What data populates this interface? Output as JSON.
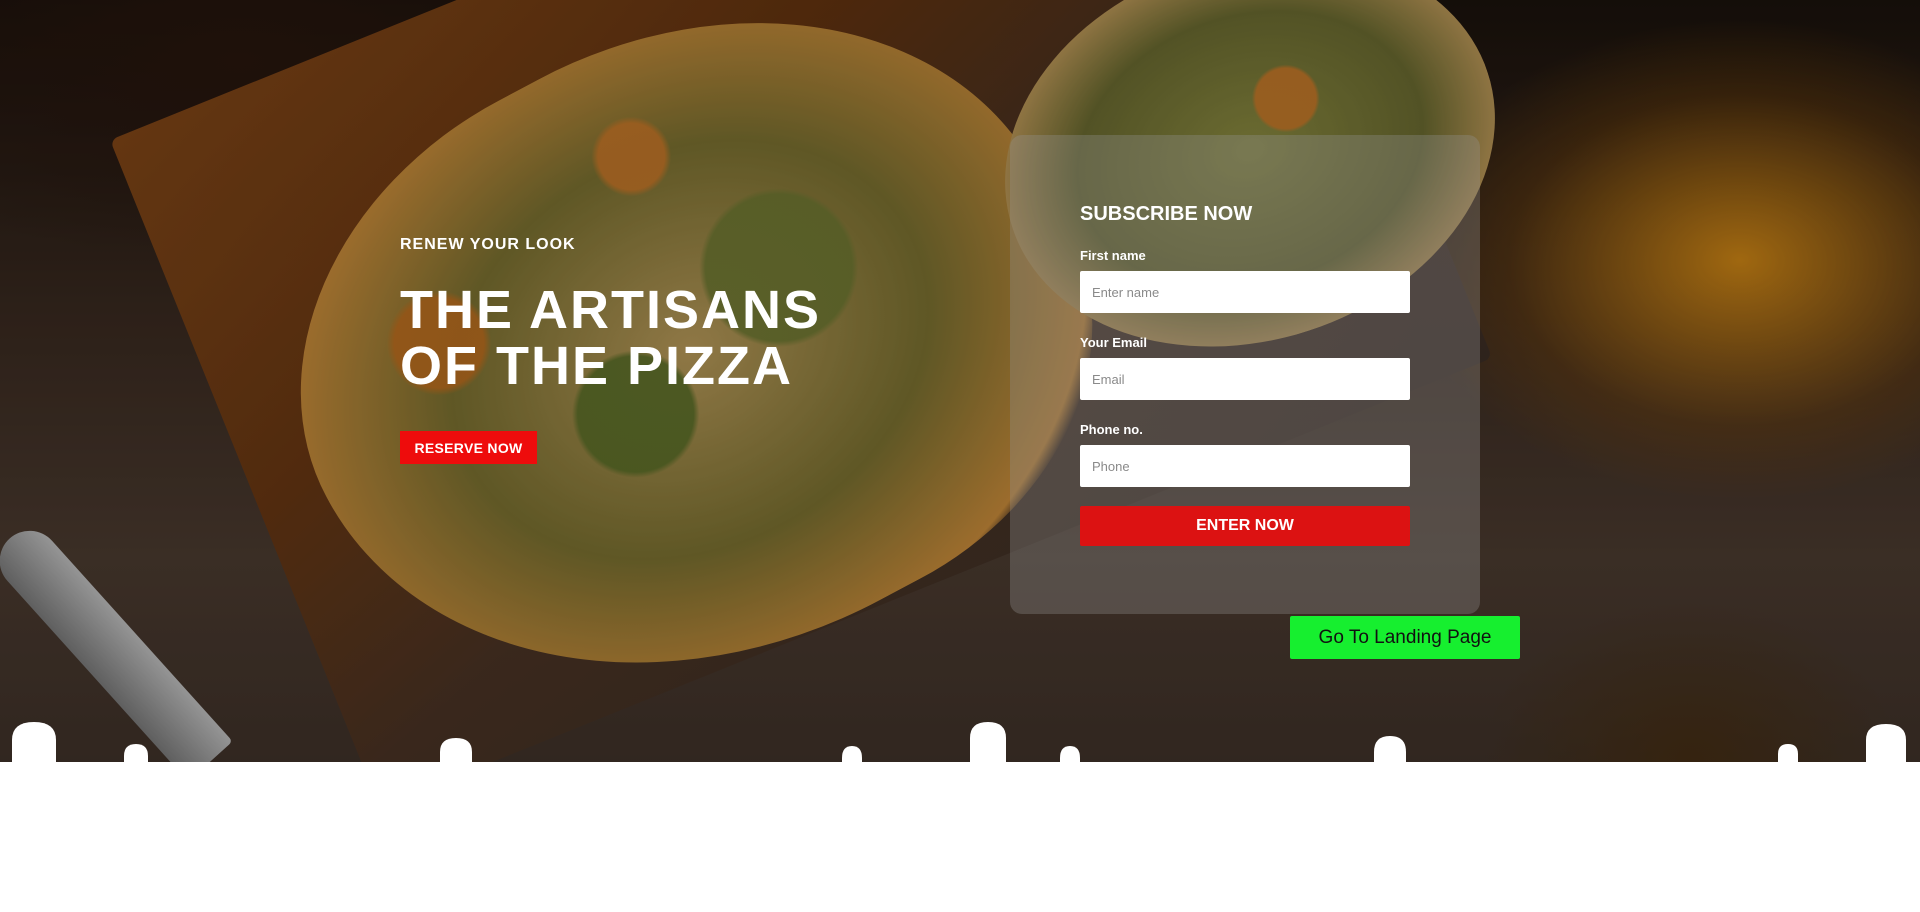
{
  "hero": {
    "tagline": "RENEW YOUR LOOK",
    "headline": "THE ARTISANS\nOF THE PIZZA",
    "reserve_label": "RESERVE NOW",
    "background_image": "pizza-on-wooden-board"
  },
  "subscribe": {
    "title": "SUBSCRIBE NOW",
    "fields": [
      {
        "label": "First name",
        "placeholder": "Enter name",
        "value": ""
      },
      {
        "label": "Your Email",
        "placeholder": "Email",
        "value": ""
      },
      {
        "label": "Phone no.",
        "placeholder": "Phone",
        "value": ""
      }
    ],
    "submit_label": "ENTER NOW"
  },
  "landing_button_label": "Go To Landing Page",
  "colors": {
    "reserve_button": "#ee0c0c",
    "submit_button": "#dc1212",
    "landing_button": "#16ef2f",
    "text_primary": "#ffffff"
  }
}
